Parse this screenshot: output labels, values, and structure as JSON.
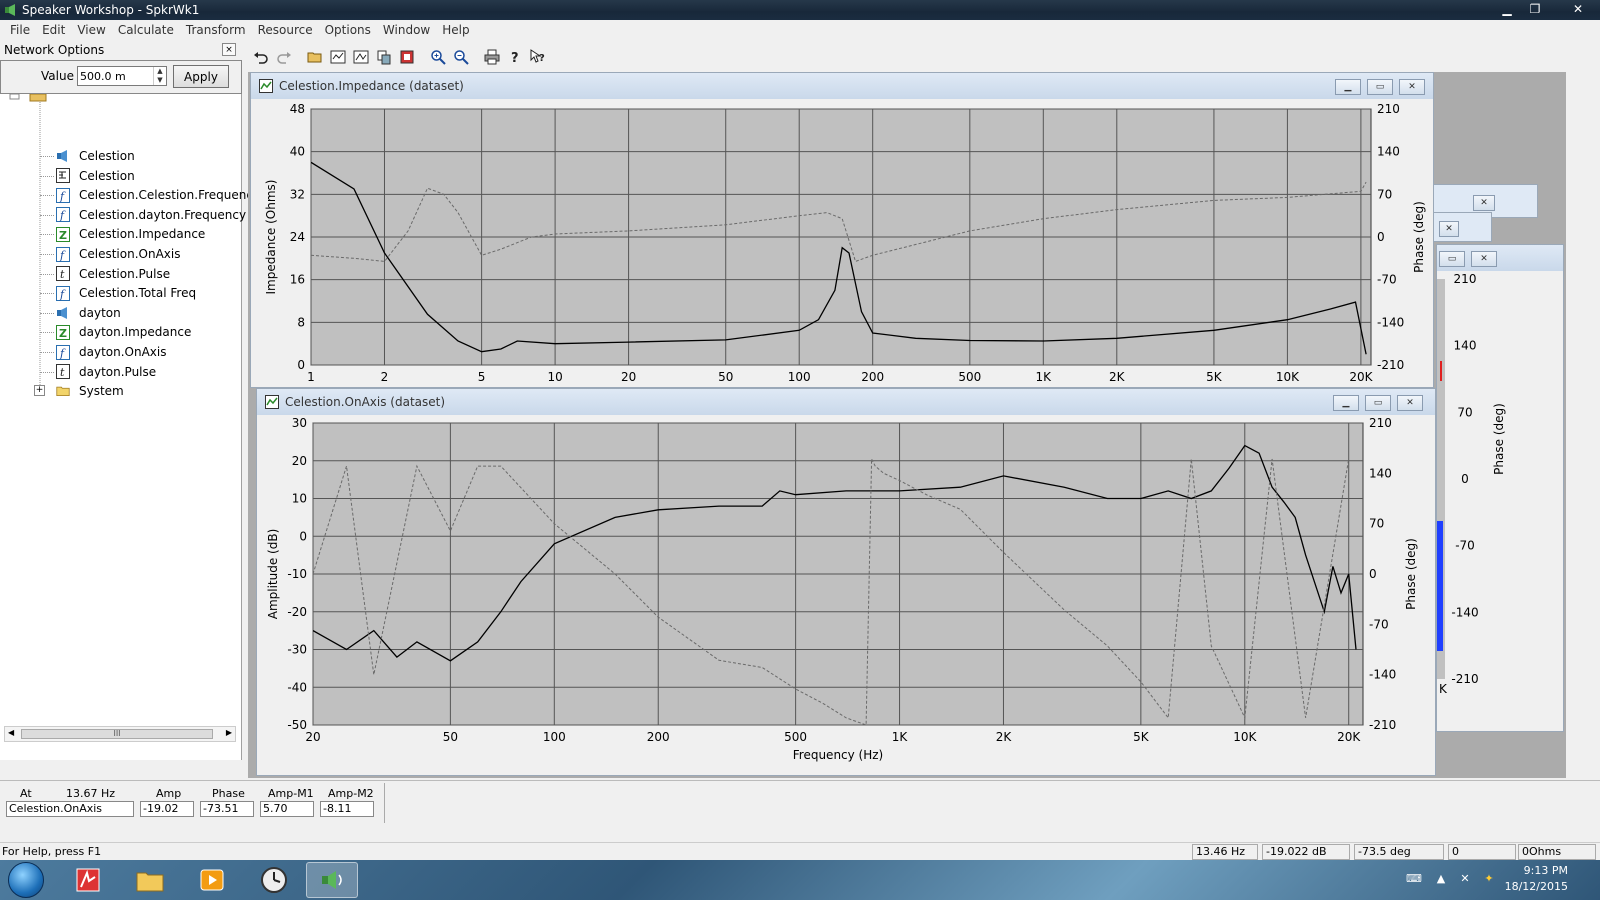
{
  "window": {
    "title": "Speaker Workshop - SpkrWk1"
  },
  "menu": [
    "File",
    "Edit",
    "View",
    "Calculate",
    "Transform",
    "Resource",
    "Options",
    "Window",
    "Help"
  ],
  "toolbar": {
    "icons": [
      "undo-icon",
      "redo-icon",
      "open-icon",
      "chart-icon",
      "chart-icon-2",
      "copy-icon",
      "paste-icon",
      "zoom-in-icon",
      "zoom-out-icon",
      "print-icon",
      "help-icon",
      "context-help-icon"
    ]
  },
  "network_options": {
    "title": "Network Options",
    "value_label": "Value",
    "value": "500.0 m",
    "apply_label": "Apply",
    "close_glyph": "×"
  },
  "tree": {
    "root_label": "SpkrWk1",
    "items": [
      {
        "label": "Celestion",
        "icon": "driver-icon"
      },
      {
        "label": "Celestion",
        "icon": "network-icon"
      },
      {
        "label": "Celestion.Celestion.Frequency",
        "icon": "frequency-icon"
      },
      {
        "label": "Celestion.dayton.Frequency",
        "icon": "frequency-icon"
      },
      {
        "label": "Celestion.Impedance",
        "icon": "impedance-icon"
      },
      {
        "label": "Celestion.OnAxis",
        "icon": "frequency-icon"
      },
      {
        "label": "Celestion.Pulse",
        "icon": "pulse-icon"
      },
      {
        "label": "Celestion.Total Freq",
        "icon": "frequency-icon"
      },
      {
        "label": "dayton",
        "icon": "driver-icon"
      },
      {
        "label": "dayton.Impedance",
        "icon": "impedance-icon"
      },
      {
        "label": "dayton.OnAxis",
        "icon": "frequency-icon"
      },
      {
        "label": "dayton.Pulse",
        "icon": "pulse-icon"
      },
      {
        "label": "System",
        "icon": "folder-icon"
      }
    ],
    "scroll_glyph": "III",
    "icon_glyphs": {
      "frequency": "f",
      "impedance": "Z",
      "pulse": "t"
    }
  },
  "chart_data": [
    {
      "type": "line",
      "title": "Celestion.Impedance (dataset)",
      "ylabel": "Impedance (Ohms)",
      "y2label": "Phase (deg)",
      "xscale": "log",
      "xlim": [
        1,
        22000
      ],
      "ylim": [
        0,
        48
      ],
      "y2lim": [
        -210,
        210
      ],
      "xticks": [
        1,
        2,
        5,
        10,
        20,
        50,
        100,
        200,
        500,
        1000,
        2000,
        5000,
        10000,
        20000
      ],
      "xtick_labels": [
        "1",
        "2",
        "5",
        "10",
        "20",
        "50",
        "100",
        "200",
        "500",
        "1K",
        "2K",
        "5K",
        "10K",
        "20K"
      ],
      "yticks": [
        0,
        8,
        16,
        24,
        32,
        40,
        48
      ],
      "y2ticks": [
        -210,
        -140,
        -70,
        0,
        70,
        140,
        210
      ],
      "grid": true,
      "series": [
        {
          "style": "solid",
          "x": [
            1,
            1.5,
            2,
            3,
            4,
            5,
            6,
            7,
            10,
            20,
            50,
            100,
            120,
            140,
            150,
            160,
            180,
            200,
            300,
            500,
            1000,
            2000,
            5000,
            10000,
            15000,
            19000,
            21000
          ],
          "y": [
            38,
            33,
            21,
            9.5,
            4.5,
            2.5,
            3.0,
            4.5,
            4.0,
            4.3,
            4.7,
            6.5,
            8.5,
            14,
            22,
            21,
            10,
            6,
            5,
            4.6,
            4.5,
            5,
            6.5,
            8.5,
            10.5,
            11.8,
            2
          ]
        },
        {
          "style": "dashed",
          "x": [
            1,
            1.5,
            2,
            2.5,
            3,
            3.5,
            4,
            5,
            6,
            8,
            10,
            20,
            50,
            100,
            130,
            150,
            170,
            200,
            500,
            1000,
            2000,
            5000,
            10000,
            20000,
            21000
          ],
          "y": [
            -30,
            -35,
            -40,
            10,
            80,
            70,
            40,
            -30,
            -20,
            0,
            5,
            10,
            20,
            35,
            40,
            30,
            -40,
            -30,
            10,
            30,
            45,
            60,
            65,
            75,
            90
          ]
        }
      ]
    },
    {
      "type": "line",
      "title": "Celestion.OnAxis (dataset)",
      "xlabel": "Frequency (Hz)",
      "ylabel": "Amplitude (dB)",
      "y2label": "Phase (deg)",
      "xscale": "log",
      "xlim": [
        20,
        22000
      ],
      "ylim": [
        -50,
        30
      ],
      "y2lim": [
        -210,
        210
      ],
      "xticks": [
        20,
        50,
        100,
        200,
        500,
        1000,
        2000,
        5000,
        10000,
        20000
      ],
      "xtick_labels": [
        "20",
        "50",
        "100",
        "200",
        "500",
        "1K",
        "2K",
        "5K",
        "10K",
        "20K"
      ],
      "yticks": [
        -50,
        -40,
        -30,
        -20,
        -10,
        0,
        10,
        20,
        30
      ],
      "y2ticks": [
        -210,
        -140,
        -70,
        0,
        70,
        140,
        210
      ],
      "grid": true,
      "series": [
        {
          "style": "solid",
          "x": [
            20,
            25,
            30,
            35,
            40,
            50,
            60,
            70,
            80,
            100,
            150,
            200,
            300,
            400,
            450,
            500,
            700,
            1000,
            1500,
            2000,
            3000,
            4000,
            5000,
            6000,
            7000,
            8000,
            9000,
            10000,
            11000,
            12000,
            13000,
            14000,
            15000,
            17000,
            18000,
            19000,
            20000,
            21000
          ],
          "y": [
            -25,
            -30,
            -25,
            -32,
            -28,
            -33,
            -28,
            -20,
            -12,
            -2,
            5,
            7,
            8,
            8,
            12,
            11,
            12,
            12,
            13,
            16,
            13,
            10,
            10,
            12,
            10,
            12,
            18,
            24,
            22,
            13,
            9,
            5,
            -5,
            -20,
            -8,
            -15,
            -10,
            -30
          ]
        },
        {
          "style": "dashed",
          "x": [
            20,
            25,
            30,
            40,
            50,
            60,
            70,
            80,
            100,
            150,
            200,
            300,
            400,
            500,
            600,
            700,
            800,
            830,
            850,
            900,
            1000,
            1200,
            1500,
            2000,
            3000,
            4000,
            5000,
            6000,
            7000,
            8000,
            10000,
            12000,
            15000,
            20000
          ],
          "y": [
            0,
            150,
            -140,
            150,
            60,
            150,
            150,
            120,
            70,
            0,
            -60,
            -120,
            -130,
            -160,
            -180,
            -200,
            -210,
            160,
            150,
            140,
            130,
            110,
            90,
            30,
            -50,
            -100,
            -150,
            -200,
            160,
            -100,
            -200,
            160,
            -200,
            160
          ]
        }
      ]
    },
    {
      "type": "line",
      "title": "",
      "y2label": "Phase (deg)",
      "y2lim": [
        -210,
        210
      ],
      "y2ticks": [
        -210,
        -140,
        -70,
        0,
        70,
        140,
        210
      ],
      "xtick_labels": [
        "K"
      ],
      "partially_hidden": true
    }
  ],
  "status": {
    "headers": [
      "At",
      "13.67 Hz",
      "Amp",
      "Phase",
      "Amp-M1",
      "Amp-M2"
    ],
    "values": [
      "Celestion.OnAxis",
      "-19.02",
      "-73.51",
      "5.70",
      "-8.11"
    ]
  },
  "helpbar": {
    "text": "For Help, press F1",
    "fields": [
      "13.46 Hz",
      "-19.022 dB",
      "-73.5 deg",
      "0",
      "0Ohms"
    ]
  },
  "taskbar": {
    "time": "9:13 PM",
    "date": "18/12/2015"
  },
  "colors": {
    "plot_bg": "#c0c0c0",
    "grid": "#555555",
    "trace": "#000000",
    "phase_trace": "#6a6a6a",
    "blue_trace": "#1f3fff",
    "red_trace": "#e02020"
  }
}
